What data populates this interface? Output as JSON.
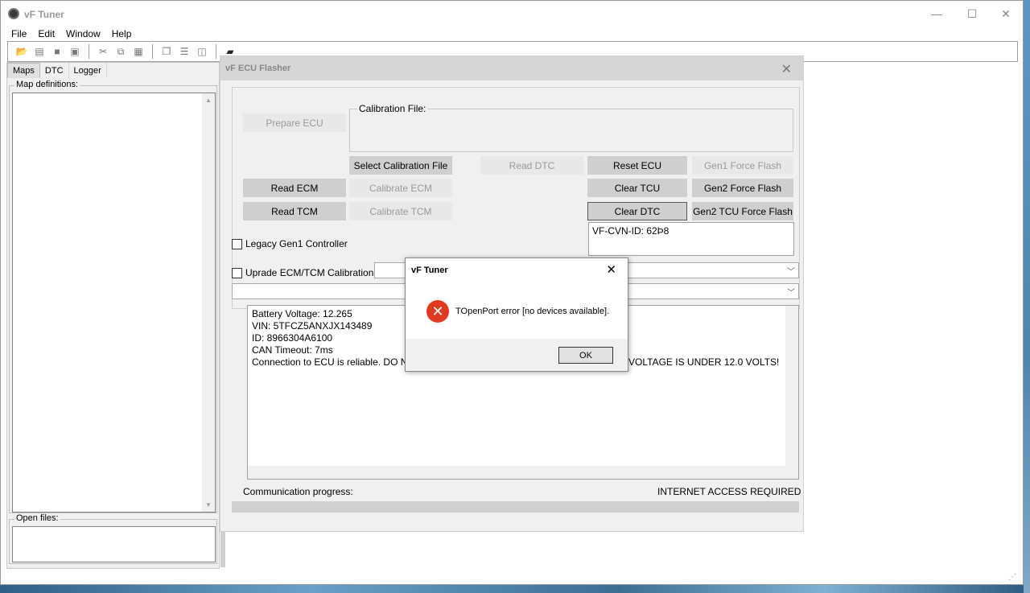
{
  "app": {
    "title": "vF Tuner",
    "menu": [
      "File",
      "Edit",
      "Window",
      "Help"
    ]
  },
  "toolbar": {
    "icons": [
      "open-folder-icon",
      "open-file-icon",
      "save-icon",
      "save-all-icon",
      "cut-icon",
      "copy-icon",
      "paste-icon",
      "cascade-icon",
      "tile-horizontal-icon",
      "tile-vertical-icon",
      "flash-chip-icon"
    ]
  },
  "left_panel": {
    "tabs": [
      "Maps",
      "DTC",
      "Logger"
    ],
    "map_definitions_label": "Map definitions:",
    "open_files_label": "Open files:"
  },
  "flasher": {
    "title": "vF ECU Flasher",
    "prepare_ecu": "Prepare ECU",
    "calibration_file_label": "Calibration File:",
    "select_calibration_file": "Select Calibration File",
    "read_dtc": "Read DTC",
    "reset_ecu": "Reset ECU",
    "gen1_force_flash": "Gen1 Force Flash",
    "read_ecm": "Read ECM",
    "calibrate_ecm": "Calibrate ECM",
    "clear_tcu": "Clear TCU",
    "gen2_force_flash": "Gen2 Force Flash",
    "read_tcm": "Read TCM",
    "calibrate_tcm": "Calibrate TCM",
    "clear_dtc": "Clear DTC",
    "gen2_tcu_force_flash": "Gen2 TCU Force Flash",
    "cvn_id": "VF-CVN-ID: 62Þ8",
    "legacy_gen1": "Legacy Gen1 Controller",
    "upgrade_calibration": "Uprade ECM/TCM Calibration",
    "log_lines": [
      "Battery Voltage: 12.265",
      "VIN: 5TFCZ5ANXJX143489",
      "ID: 8966304A6100",
      "CAN Timeout: 7ms",
      "Connection to ECU is reliable. DO NO",
      "VOLTAGE IS UNDER 12.0 VOLTS!"
    ],
    "communication_progress": "Communication progress:",
    "internet_access": "INTERNET ACCESS REQUIRED",
    "progress": 0
  },
  "dialog": {
    "title": "vF Tuner",
    "message": "TOpenPort error [no devices available].",
    "ok": "OK",
    "icon": "error-icon"
  }
}
